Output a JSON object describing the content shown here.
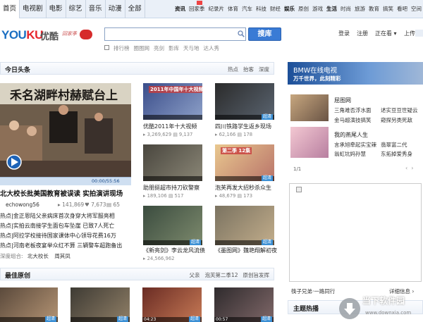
{
  "nav": {
    "primary": [
      "首页",
      "电视剧",
      "电影",
      "综艺",
      "音乐",
      "动漫",
      "全部"
    ],
    "secondary": [
      {
        "label": "资讯",
        "bold": true
      },
      {
        "label": "回家季"
      },
      {
        "label": "纪录片"
      },
      {
        "label": "体育"
      },
      {
        "label": "汽车"
      },
      {
        "label": "科技"
      },
      {
        "label": "财经"
      },
      {
        "label": "娱乐",
        "bold": true
      },
      {
        "label": "原创"
      },
      {
        "label": "游戏"
      },
      {
        "label": "生活",
        "bold": true
      },
      {
        "label": "时尚"
      },
      {
        "label": "旅游"
      },
      {
        "label": "教育"
      },
      {
        "label": "搞笑"
      },
      {
        "label": "看吧"
      },
      {
        "label": "空间"
      }
    ]
  },
  "logo": {
    "text_en": "YOUKU",
    "text_cn": "优酷",
    "slogan": "回家季"
  },
  "search": {
    "placeholder": "",
    "button": "搜库"
  },
  "quicklinks": [
    "排行榜",
    "圈图网",
    "亮剑",
    "影库",
    "天与地",
    "达人秀"
  ],
  "user": {
    "login": "登录",
    "register": "注册",
    "watching": "正在看",
    "upload": "上传"
  },
  "today": {
    "title": "今日头条",
    "tabs": [
      "热点",
      "抬客",
      "深度"
    ]
  },
  "hero": {
    "banner": "禾名湖畔村赫赋台上",
    "time": "00:00/55:56",
    "title": "北大校长批美国教育被误读 实拍演讲现场",
    "user": "echowong56",
    "views": "141,869",
    "likes": "7,673",
    "comments": "65"
  },
  "news": [
    "热点|金正恩陆父亲病床首次身穿大将军服亮相",
    "热点|实拍云南接学生面包车坠崖 已致7人死亡",
    "热点|阿拉学校接待国家课体中心领导花费16万",
    "热点|河南老板夜宴举众红不算 三辆警车超跑备出"
  ],
  "tags": {
    "label": "深度组合:",
    "items": [
      "北大校长",
      "周其凤"
    ]
  },
  "thumbs": [
    {
      "banner": "2011年中国年十大视频",
      "title": "优酷2011年十大视频",
      "views": "3,269,629",
      "comments": "9,137",
      "hd": false,
      "colors": [
        "#3a4d8a",
        "#8da0c8"
      ]
    },
    {
      "banner": "",
      "title": "四川铁路学生返乡现场",
      "views": "62,166",
      "comments": "178",
      "hd": true,
      "colors": [
        "#2b2b2b",
        "#5a6470"
      ]
    },
    {
      "banner": "",
      "title": "助朋挺超市持刀砍警察",
      "views": "189,106",
      "comments": "517",
      "hd": false,
      "colors": [
        "#49463e",
        "#8a8676"
      ]
    },
    {
      "banner": "第二季 12集",
      "title": "泡芙再发大招秒杀众生",
      "views": "48,679",
      "comments": "173",
      "hd": true,
      "colors": [
        "#e9c88f",
        "#b9746a"
      ]
    },
    {
      "banner": "",
      "title": "《新亮剑》李云龙风流债",
      "views": "24,566,962",
      "comments": "",
      "hd": true,
      "colors": [
        "#3b4c3f",
        "#7d8a6d"
      ]
    },
    {
      "banner": "",
      "title": "《墨图网》魏艳翔解初夜",
      "views": "",
      "comments": "",
      "hd": true,
      "colors": [
        "#7b7361",
        "#c2ad8b"
      ]
    }
  ],
  "original": {
    "title": "最佳原创",
    "tabs": [
      "父亲",
      "泡芙第二季12",
      "原创旨发挥"
    ],
    "thumbs": [
      {
        "time": "",
        "hd": true
      },
      {
        "time": "",
        "hd": true
      },
      {
        "time": "04:23",
        "hd": true
      },
      {
        "time": "00:57",
        "hd": true
      }
    ]
  },
  "ad": {
    "title": "BMW在线电视",
    "subtitle": "万千世界，此刻精彩"
  },
  "promos": [
    {
      "title": "屈图网",
      "items": [
        "三角难否浮水面",
        "述实豆豆世疑云",
        "金马超演技搞笑",
        "窥探另类死敌"
      ]
    },
    {
      "title": "我的燕尾人生",
      "items": [
        "言承旭牵起实宝辣",
        "翡翠富二代",
        "翁虹坑妈孙慧",
        "东拓掉爱秀身"
      ]
    }
  ],
  "pager": "1/1",
  "ad_footer": {
    "left": "筷子兄弟·一路同行",
    "right": "详细信息"
  },
  "right_foot": {
    "title": "主题热播"
  },
  "watermark": {
    "name": "当下软件园",
    "url": "www.downxia.com"
  }
}
